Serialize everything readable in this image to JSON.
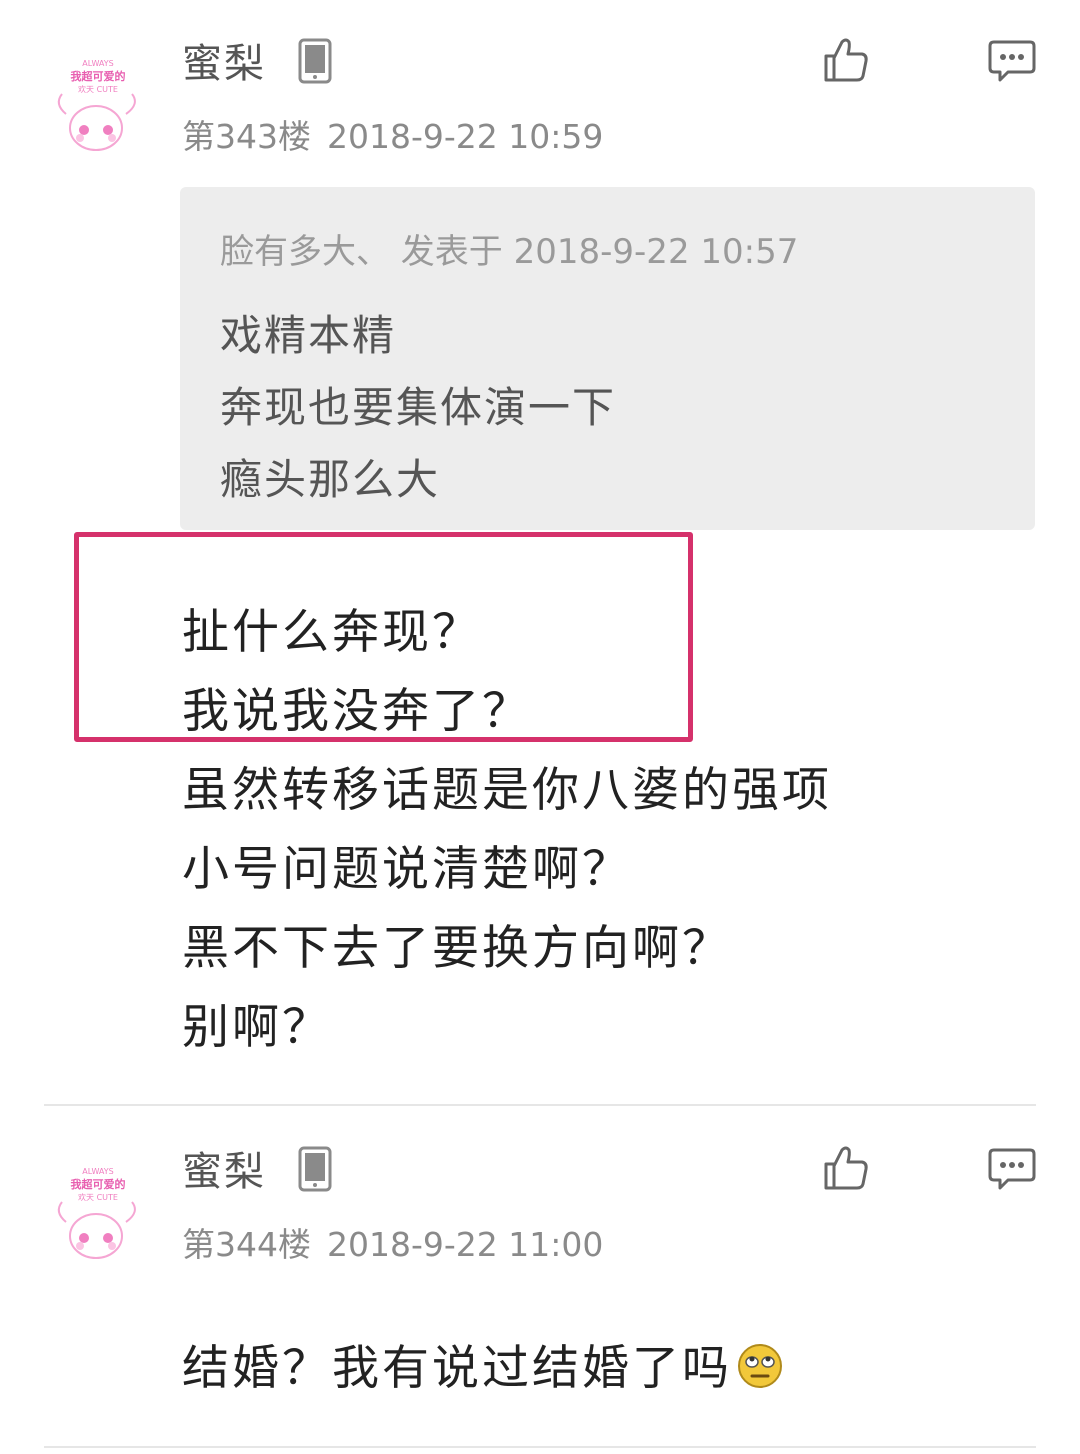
{
  "posts": [
    {
      "username": "蜜梨",
      "floor": "第343楼",
      "timestamp": "2018-9-22 10:59",
      "avatar_text": {
        "line1": "我超可爱的",
        "line2": "欢天 CUTE",
        "small": "ALWAYS"
      },
      "quote": {
        "header": "脸有多大、 发表于 2018-9-22 10:57",
        "lines": [
          "戏精本精",
          "奔现也要集体演一下",
          "瘾头那么大"
        ]
      },
      "content_lines": [
        "扯什么奔现？",
        "我说我没奔了？",
        "虽然转移话题是你八婆的强项",
        "小号问题说清楚啊？",
        "黑不下去了要换方向啊？",
        "别啊？"
      ],
      "highlight_color": "#d5316b"
    },
    {
      "username": "蜜梨",
      "floor": "第344楼",
      "timestamp": "2018-9-22 11:00",
      "avatar_text": {
        "line1": "我超可爱的",
        "line2": "欢天 CUTE",
        "small": "ALWAYS"
      },
      "content_lines": [
        "结婚？我有说过结婚了吗"
      ],
      "emoji": "rolling-eyes-emoji"
    }
  ],
  "icons": {
    "device": "phone-icon",
    "like": "thumbs-up-icon",
    "reply": "comment-bubble-icon"
  },
  "colors": {
    "accent_pink": "#f07fc0",
    "highlight_border": "#d5316b",
    "quote_bg": "#ededed"
  }
}
